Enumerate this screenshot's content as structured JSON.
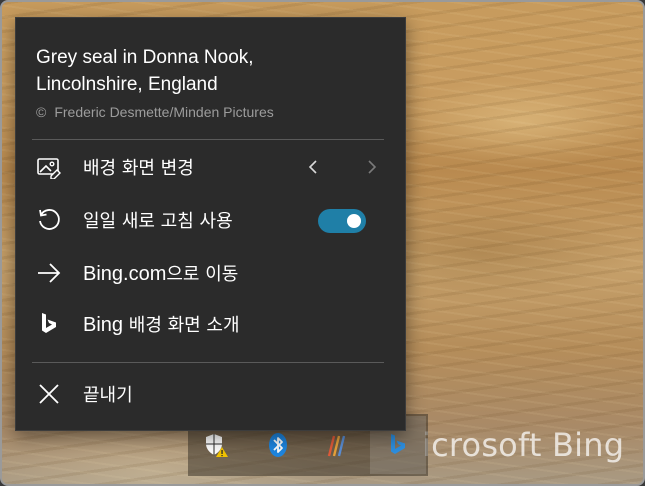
{
  "caption": {
    "title_line1": "Grey seal in Donna Nook,",
    "title_line2": "Lincolnshire, England",
    "copyright_symbol": "©",
    "copyright_text": "Frederic Desmette/Minden Pictures"
  },
  "menu": {
    "change_wallpaper": {
      "label": "배경 화면 변경",
      "icon": "image-edit-icon"
    },
    "daily_refresh": {
      "label": "일일 새로 고침 사용",
      "icon": "refresh-icon",
      "enabled": true
    },
    "go_to_bing": {
      "label_en": "Bing.com",
      "label_ko": "으로 이동",
      "icon": "arrow-right-icon"
    },
    "about_bing_wallpaper": {
      "label_en": "Bing",
      "label_ko": " 배경 화면 소개",
      "icon": "bing-logo-icon"
    },
    "exit": {
      "label": "끝내기",
      "icon": "close-icon"
    }
  },
  "wallpaper": {
    "brand_text": "icrosoft Bing"
  },
  "tray": {
    "icons": [
      "windows-security-warning-icon",
      "bluetooth-icon",
      "stylus-app-icon",
      "bing-wallpaper-icon"
    ]
  },
  "colors": {
    "menu_bg": "#2b2b2b",
    "toggle_on": "#1f7fa7",
    "muted_text": "#9c9c9c"
  }
}
